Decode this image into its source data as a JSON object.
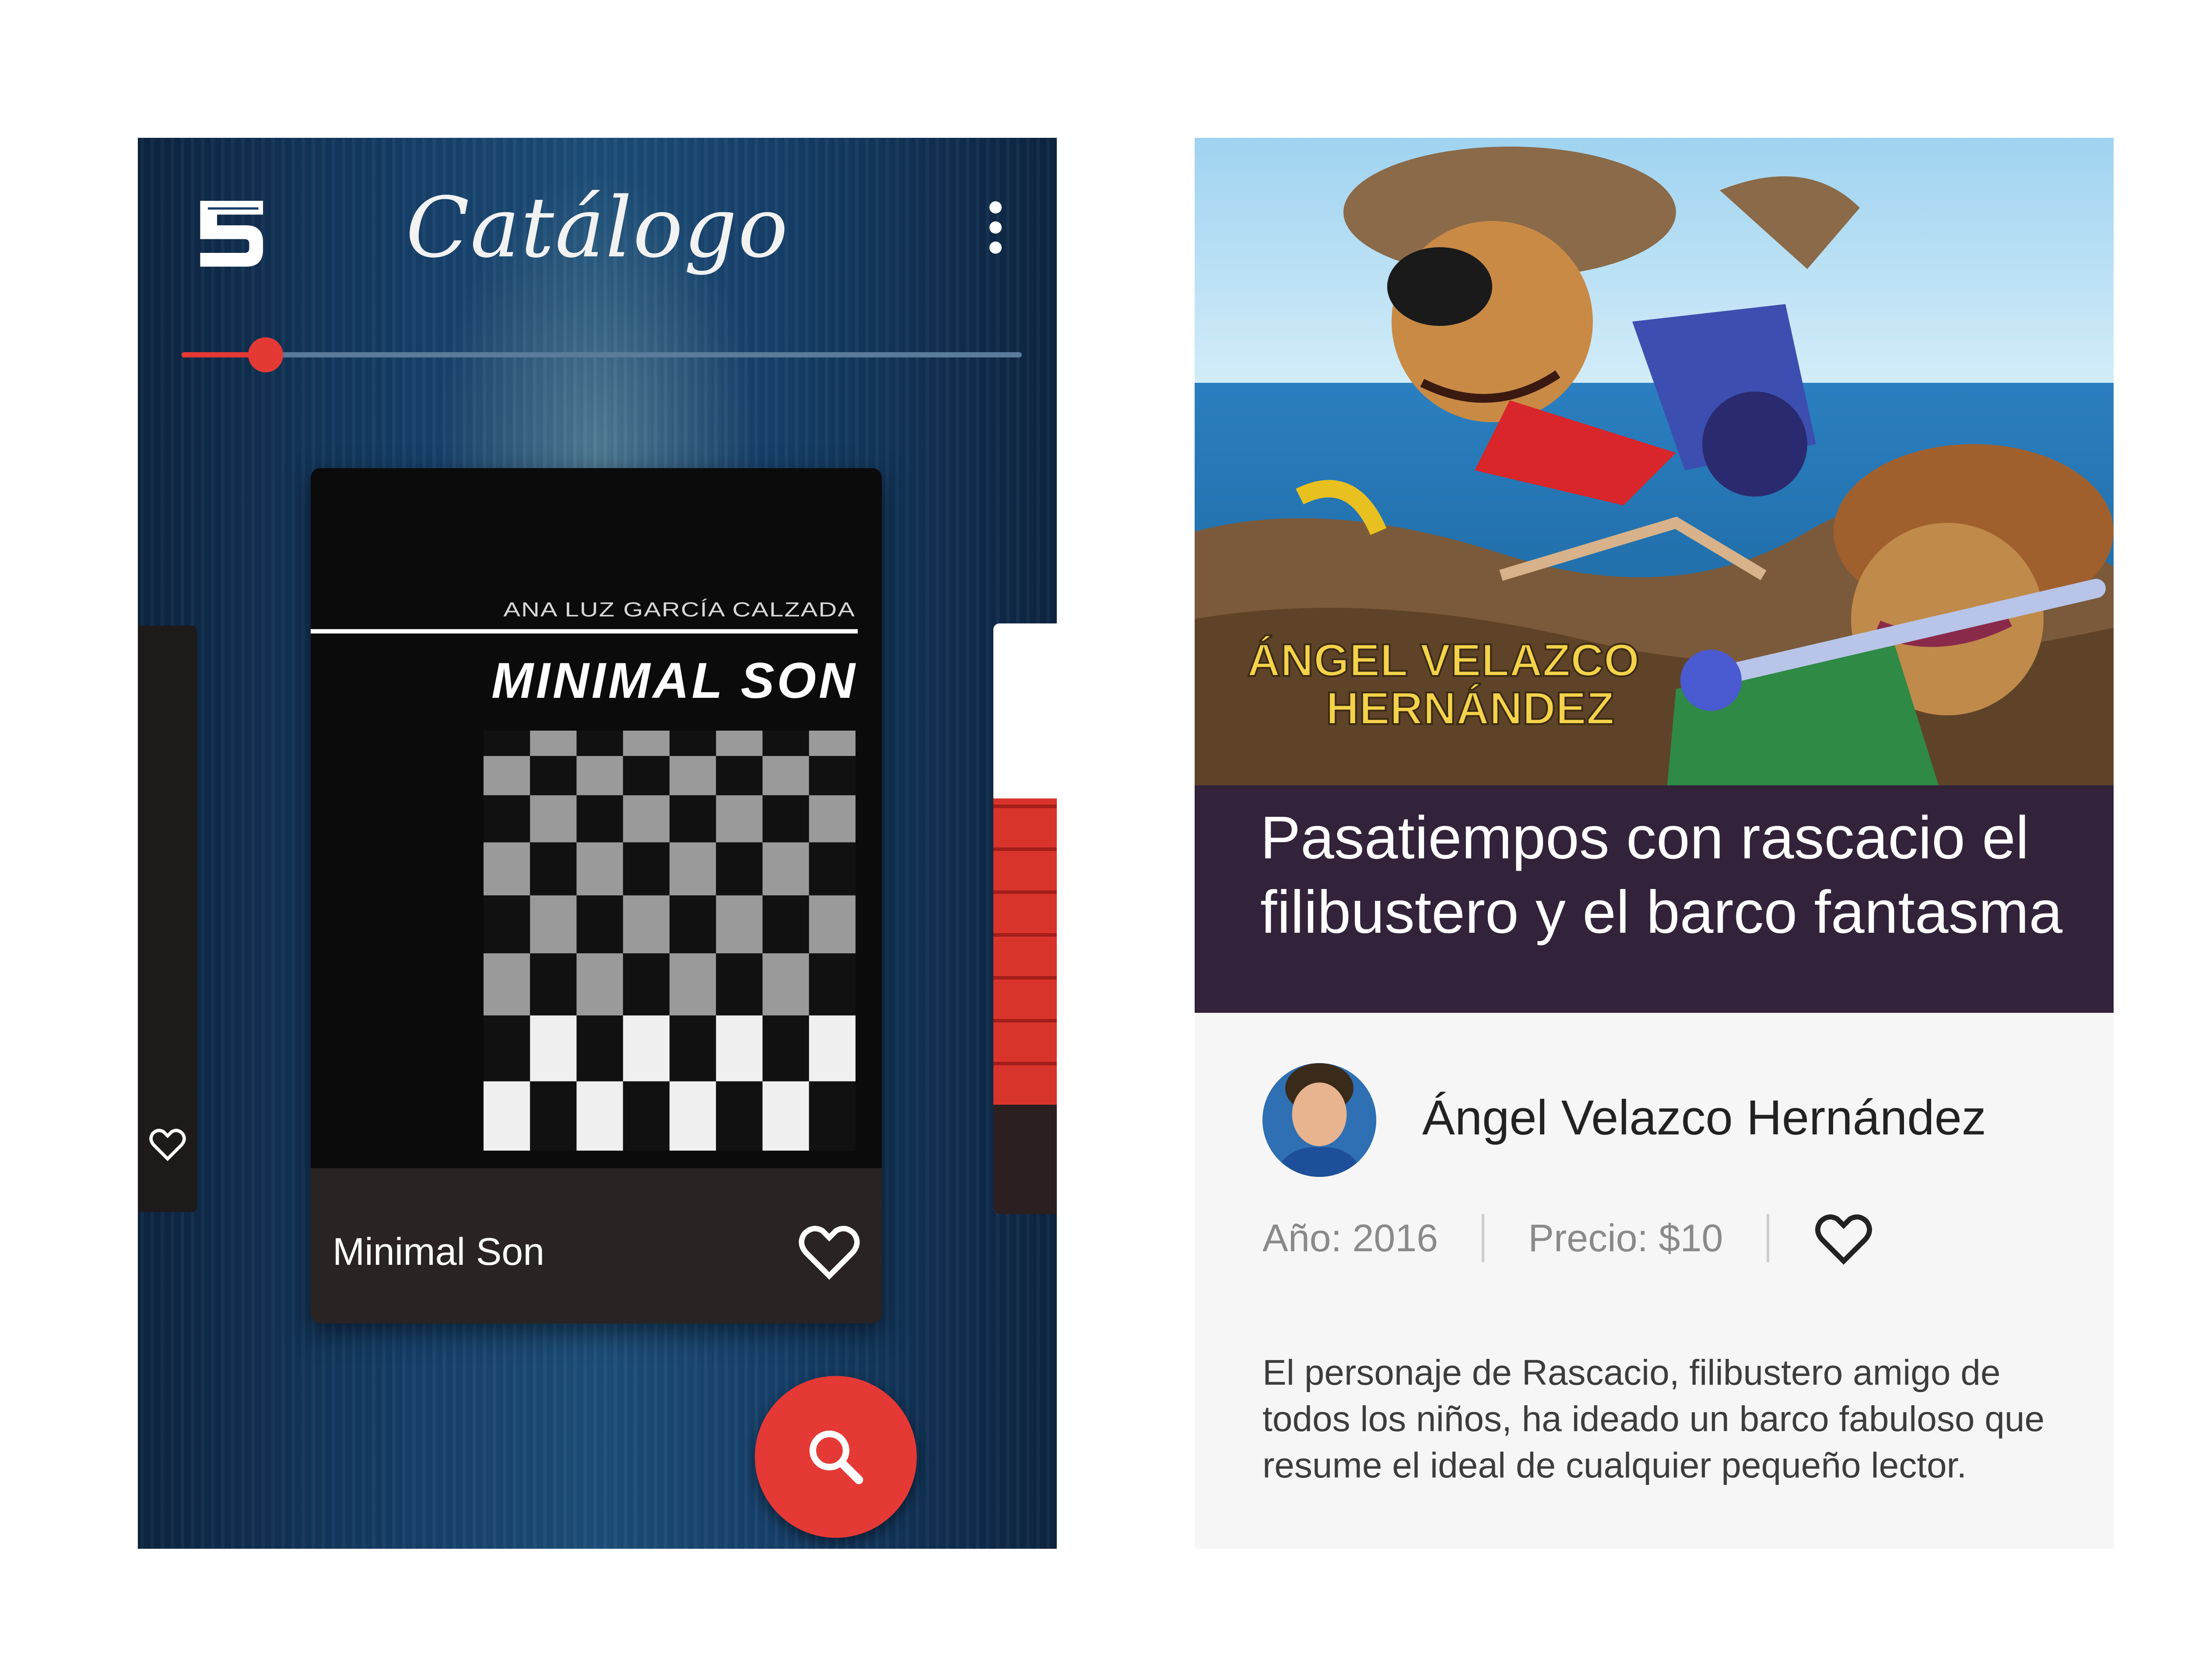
{
  "catalog_screen": {
    "title": "Catálogo",
    "slider_position": 0.1,
    "featured_book": {
      "cover_author": "ANA LUZ GARCÍA CALZADA",
      "cover_title": "MINIMAL SON",
      "name": "Minimal Son"
    },
    "icons": {
      "logo": "channel-5-logo-icon",
      "menu": "more-vertical-icon",
      "favorite": "heart-outline-icon",
      "search": "search-icon"
    },
    "colors": {
      "accent": "#e53935",
      "background": "#16406a",
      "card_footer": "#2a2323"
    }
  },
  "detail_screen": {
    "book_title": "Pasatiempos con rascacio el filibustero y el barco fantasma",
    "cover_text": "ÁNGEL VELAZCO HERNÁNDEZ",
    "author_name": "Ángel Velazco Hernández",
    "year_label": "Año: 2016",
    "price_label": "Precio: $10",
    "description": "El personaje de Rascacio, filibustero amigo de todos los niños, ha ideado un barco fabuloso que resume el ideal de cualquier pequeño lector.",
    "colors": {
      "title_band": "#32223a",
      "background": "#f6f6f6"
    }
  }
}
